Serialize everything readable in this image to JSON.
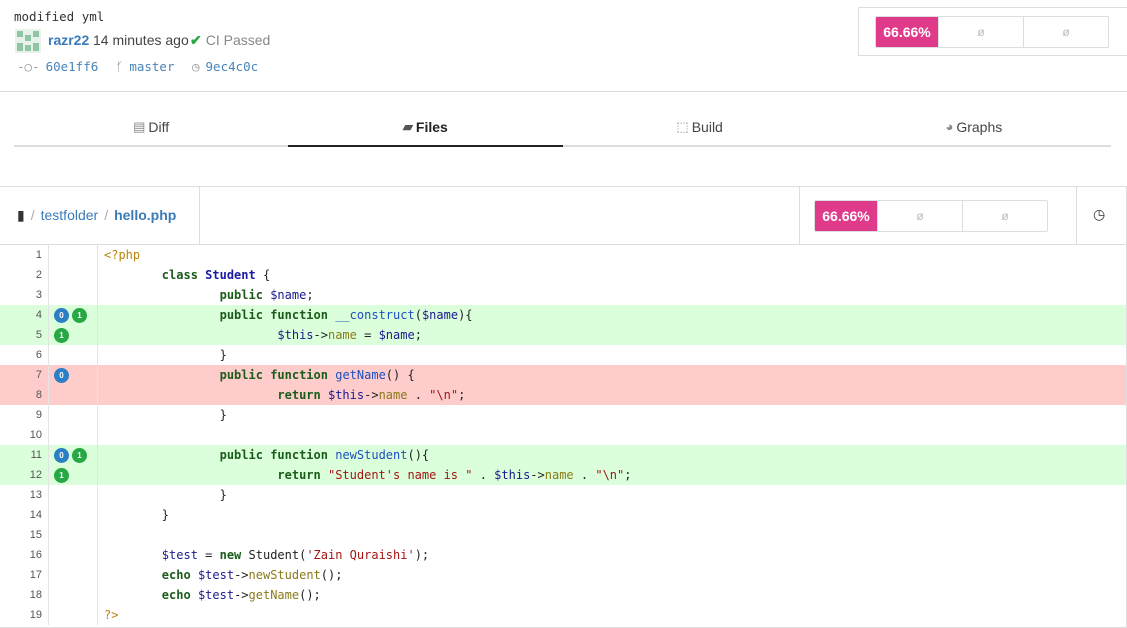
{
  "commit": {
    "message": "modified yml",
    "author": "razr22",
    "time": "14 minutes ago",
    "ci_status": "CI Passed",
    "sha": "60e1ff6",
    "branch": "master",
    "parent": "9ec4c0c"
  },
  "coverage": {
    "percent": "66.66%",
    "diff": "ø",
    "change": "ø"
  },
  "tabs": [
    {
      "label": "Diff",
      "icon": "file-diff-icon"
    },
    {
      "label": "Files",
      "icon": "folder-icon"
    },
    {
      "label": "Build",
      "icon": "package-icon"
    },
    {
      "label": "Graphs",
      "icon": "pie-chart-icon"
    }
  ],
  "active_tab": "Files",
  "file": {
    "folder": "testfolder",
    "name": "hello.php",
    "coverage": "66.66%",
    "diff": "ø",
    "change": "ø"
  },
  "colors": {
    "accent": "#e03b8b",
    "hit": "#dbffdb",
    "miss": "#ffcccc"
  },
  "lines": [
    {
      "n": "1",
      "status": "",
      "badges": []
    },
    {
      "n": "2",
      "status": "",
      "badges": []
    },
    {
      "n": "3",
      "status": "",
      "badges": []
    },
    {
      "n": "4",
      "status": "hit",
      "badges": [
        [
          "b",
          "0"
        ],
        [
          "g",
          "1"
        ]
      ]
    },
    {
      "n": "5",
      "status": "hit",
      "badges": [
        [
          "g",
          "1"
        ]
      ]
    },
    {
      "n": "6",
      "status": "",
      "badges": []
    },
    {
      "n": "7",
      "status": "miss",
      "badges": [
        [
          "b",
          "0"
        ]
      ]
    },
    {
      "n": "8",
      "status": "miss",
      "badges": []
    },
    {
      "n": "9",
      "status": "",
      "badges": []
    },
    {
      "n": "10",
      "status": "",
      "badges": []
    },
    {
      "n": "11",
      "status": "hit",
      "badges": [
        [
          "b",
          "0"
        ],
        [
          "g",
          "1"
        ]
      ]
    },
    {
      "n": "12",
      "status": "hit",
      "badges": [
        [
          "g",
          "1"
        ]
      ]
    },
    {
      "n": "13",
      "status": "",
      "badges": []
    },
    {
      "n": "14",
      "status": "",
      "badges": []
    },
    {
      "n": "15",
      "status": "",
      "badges": []
    },
    {
      "n": "16",
      "status": "",
      "badges": []
    },
    {
      "n": "17",
      "status": "",
      "badges": []
    },
    {
      "n": "18",
      "status": "",
      "badges": []
    },
    {
      "n": "19",
      "status": "",
      "badges": []
    }
  ],
  "code": [
    [
      [
        "tag",
        "<?php"
      ]
    ],
    [
      [
        "",
        "        "
      ],
      [
        "kw",
        "class"
      ],
      [
        "",
        " "
      ],
      [
        "cls",
        "Student"
      ],
      [
        "",
        " {"
      ]
    ],
    [
      [
        "",
        "                "
      ],
      [
        "kw",
        "public"
      ],
      [
        "",
        " "
      ],
      [
        "var",
        "$name"
      ],
      [
        "",
        ";"
      ]
    ],
    [
      [
        "",
        "                "
      ],
      [
        "kw",
        "public"
      ],
      [
        "",
        " "
      ],
      [
        "kw",
        "function"
      ],
      [
        "",
        " "
      ],
      [
        "fn",
        "__construct"
      ],
      [
        "",
        "("
      ],
      [
        "var",
        "$name"
      ],
      [
        "",
        "){"
      ]
    ],
    [
      [
        "",
        "                        "
      ],
      [
        "var",
        "$this"
      ],
      [
        "",
        "->"
      ],
      [
        "prop",
        "name"
      ],
      [
        "",
        " = "
      ],
      [
        "var",
        "$name"
      ],
      [
        "",
        ";"
      ]
    ],
    [
      [
        "",
        "                }"
      ]
    ],
    [
      [
        "",
        "                "
      ],
      [
        "kw",
        "public"
      ],
      [
        "",
        " "
      ],
      [
        "kw",
        "function"
      ],
      [
        "",
        " "
      ],
      [
        "fn",
        "getName"
      ],
      [
        "",
        "() {"
      ]
    ],
    [
      [
        "",
        "                        "
      ],
      [
        "kw",
        "return"
      ],
      [
        "",
        " "
      ],
      [
        "var",
        "$this"
      ],
      [
        "",
        "->"
      ],
      [
        "prop",
        "name"
      ],
      [
        "",
        " . "
      ],
      [
        "str",
        "\"\\n\""
      ],
      [
        "",
        ";"
      ]
    ],
    [
      [
        "",
        "                }"
      ]
    ],
    [
      [
        "",
        ""
      ]
    ],
    [
      [
        "",
        "                "
      ],
      [
        "kw",
        "public"
      ],
      [
        "",
        " "
      ],
      [
        "kw",
        "function"
      ],
      [
        "",
        " "
      ],
      [
        "fn",
        "newStudent"
      ],
      [
        "",
        "(){"
      ]
    ],
    [
      [
        "",
        "                        "
      ],
      [
        "kw",
        "return"
      ],
      [
        "",
        " "
      ],
      [
        "str",
        "\"Student's name is \""
      ],
      [
        "",
        " . "
      ],
      [
        "var",
        "$this"
      ],
      [
        "",
        "->"
      ],
      [
        "prop",
        "name"
      ],
      [
        "",
        " . "
      ],
      [
        "str",
        "\"\\n\""
      ],
      [
        "",
        ";"
      ]
    ],
    [
      [
        "",
        "                }"
      ]
    ],
    [
      [
        "",
        "        }"
      ]
    ],
    [
      [
        "",
        ""
      ]
    ],
    [
      [
        "",
        "        "
      ],
      [
        "var",
        "$test"
      ],
      [
        "",
        " = "
      ],
      [
        "kw",
        "new"
      ],
      [
        "",
        " Student("
      ],
      [
        "str",
        "'Zain Quraishi'"
      ],
      [
        "",
        ");"
      ]
    ],
    [
      [
        "",
        "        "
      ],
      [
        "kw",
        "echo"
      ],
      [
        "",
        " "
      ],
      [
        "var",
        "$test"
      ],
      [
        "",
        "->"
      ],
      [
        "prop",
        "newStudent"
      ],
      [
        "",
        "();"
      ]
    ],
    [
      [
        "",
        "        "
      ],
      [
        "kw",
        "echo"
      ],
      [
        "",
        " "
      ],
      [
        "var",
        "$test"
      ],
      [
        "",
        "->"
      ],
      [
        "prop",
        "getName"
      ],
      [
        "",
        "();"
      ]
    ],
    [
      [
        "tag",
        "?>"
      ]
    ]
  ]
}
